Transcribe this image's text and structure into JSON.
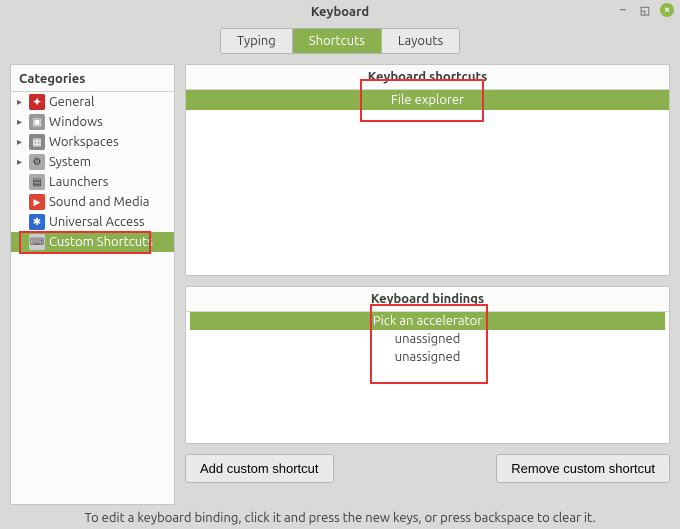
{
  "window": {
    "title": "Keyboard"
  },
  "tabs": {
    "typing": "Typing",
    "shortcuts": "Shortcuts",
    "layouts": "Layouts"
  },
  "categories": {
    "header": "Categories",
    "items": [
      {
        "label": "General"
      },
      {
        "label": "Windows"
      },
      {
        "label": "Workspaces"
      },
      {
        "label": "System"
      },
      {
        "label": "Launchers"
      },
      {
        "label": "Sound and Media"
      },
      {
        "label": "Universal Access"
      },
      {
        "label": "Custom Shortcuts"
      }
    ]
  },
  "shortcuts_panel": {
    "header": "Keyboard shortcuts",
    "selected": "File explorer"
  },
  "bindings_panel": {
    "header": "Keyboard bindings",
    "rows": [
      "Pick an accelerator",
      "unassigned",
      "unassigned"
    ]
  },
  "buttons": {
    "add": "Add custom shortcut",
    "remove": "Remove custom shortcut"
  },
  "hint": "To edit a keyboard binding, click it and press the new keys, or press backspace to clear it."
}
